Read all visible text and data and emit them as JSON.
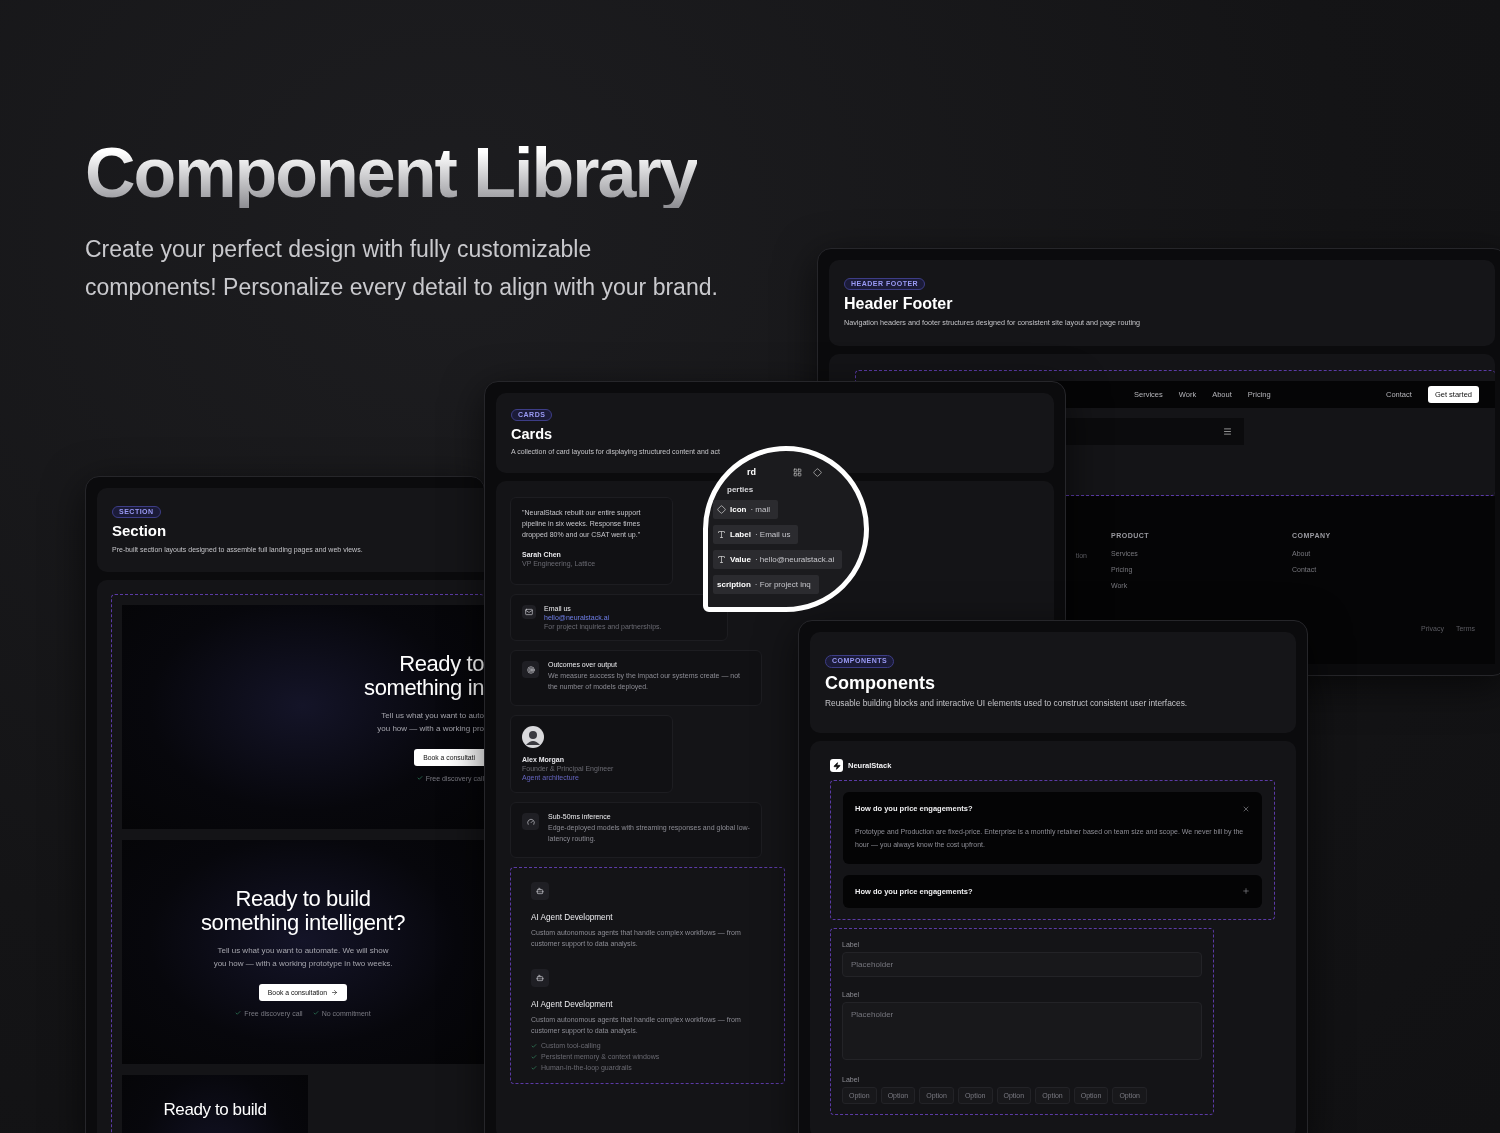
{
  "hero": {
    "title": "Component Library",
    "subtitle_lines": [
      "Create your perfect design with fully customizable",
      "components! Personalize every detail to align with your brand."
    ]
  },
  "header_footer_panel": {
    "badge": "HEADER FOOTER",
    "title": "Header Footer",
    "description": "Navigation headers and footer structures designed for consistent site layout and page routing",
    "nav_links": [
      "Services",
      "Work",
      "About",
      "Pricing"
    ],
    "contact_link": "Contact",
    "cta": "Get started",
    "footer_fragment": "tion",
    "footer_columns": [
      {
        "heading": "PRODUCT",
        "links": [
          "Services",
          "Pricing",
          "Work"
        ]
      },
      {
        "heading": "COMPANY",
        "links": [
          "About",
          "Contact"
        ]
      }
    ],
    "legal_links": [
      "Privacy",
      "Terms"
    ]
  },
  "section_panel": {
    "badge": "SECTION",
    "title": "Section",
    "description": "Pre-built section layouts designed to assemble full landing pages and web views.",
    "heroes": [
      {
        "kind": "offset",
        "title_lines": [
          "Ready to",
          "something in"
        ],
        "body_lines": [
          "Tell us what you want to auto",
          "you how — with a working pro"
        ],
        "button": "Book a consultati",
        "arrow": false,
        "perks": [
          "Free discovery call"
        ]
      },
      {
        "kind": "centered",
        "title_lines": [
          "Ready to build",
          "something intelligent?"
        ],
        "body_lines": [
          "Tell us what you want to automate. We will show",
          "you how — with a working prototype in two weeks."
        ],
        "button": "Book a consultation",
        "arrow": true,
        "perks": [
          "Free discovery call",
          "No commitment"
        ]
      },
      {
        "kind": "compact",
        "title_lines": [
          "Ready to build"
        ]
      }
    ]
  },
  "cards_panel": {
    "badge": "CARDS",
    "title": "Cards",
    "description": "A collection of card layouts for displaying structured content and act",
    "cards": [
      {
        "kind": "testimonial",
        "quote": "\"NeuralStack rebuilt our entire support pipeline in six weeks. Response times dropped 80% and our CSAT went up.\"",
        "name": "Sarah Chen",
        "role": "VP Engineering, Lattice"
      },
      {
        "kind": "contact",
        "label": "Email us",
        "value": "hello@neuralstack.ai",
        "note": "For project inquiries and partnerships."
      },
      {
        "kind": "feature",
        "title": "Outcomes over output",
        "text": "We measure success by the impact our systems create — not the number of models deployed."
      },
      {
        "kind": "profile",
        "name": "Alex Morgan",
        "role": "Founder & Principal Engineer",
        "tag": "Agent architecture"
      },
      {
        "kind": "feature",
        "title": "Sub-50ms inference",
        "text": "Edge-deployed models with streaming responses and global low-latency routing."
      },
      {
        "kind": "services",
        "items": [
          {
            "title": "AI Agent Development",
            "text": "Custom autonomous agents that handle complex workflows — from customer support to data analysis."
          },
          {
            "title": "AI Agent Development",
            "text": "Custom autonomous agents that handle complex workflows — from customer support to data analysis.",
            "bullets": [
              "Custom tool-calling",
              "Persistent memory & context windows",
              "Human-in-the-loop guardrails"
            ]
          }
        ]
      }
    ]
  },
  "magnifier": {
    "title_fragment": "rd",
    "section_fragment": "perties",
    "rows": [
      {
        "kind": "icon",
        "name": "Icon",
        "value": "· mail"
      },
      {
        "kind": "text",
        "name": "Label",
        "value": "· Email us"
      },
      {
        "kind": "text",
        "name": "Value",
        "value": "· hello@neuralstack.ai"
      },
      {
        "kind": "cut",
        "name": "scription",
        "value": "· For project inq"
      }
    ]
  },
  "components_panel": {
    "badge": "COMPONENTS",
    "title": "Components",
    "description": "Reusable building blocks and interactive UI elements used to construct consistent user interfaces.",
    "brand": "NeuralStack",
    "faq": [
      {
        "question": "How do you price engagements?",
        "answer": "Prototype and Production are fixed-price. Enterprise is a monthly retainer based on team size and scope. We never bill by the hour — you always know the cost upfront.",
        "expanded": true
      },
      {
        "question": "How do you price engagements?",
        "expanded": false
      }
    ],
    "fields": [
      {
        "kind": "input",
        "label": "Label",
        "placeholder": "Placeholder"
      },
      {
        "kind": "textarea",
        "label": "Label",
        "placeholder": "Placeholder"
      }
    ],
    "chips_label": "Label",
    "chips": [
      "Option",
      "Option",
      "Option",
      "Option",
      "Option",
      "Option",
      "Option",
      "Option"
    ]
  }
}
